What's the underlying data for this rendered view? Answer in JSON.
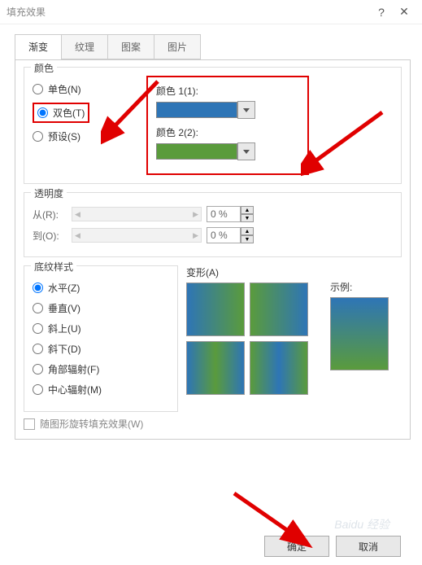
{
  "window": {
    "title": "填充效果",
    "help": "?",
    "close": "✕"
  },
  "tabs": {
    "gradient": "渐变",
    "texture": "纹理",
    "pattern": "图案",
    "picture": "图片"
  },
  "color": {
    "group": "颜色",
    "single": "单色(N)",
    "dual": "双色(T)",
    "preset": "预设(S)",
    "c1label": "颜色 1(1):",
    "c2label": "颜色 2(2):",
    "c1hex": "#2e75b6",
    "c2hex": "#5a9b3c"
  },
  "trans": {
    "group": "透明度",
    "from": "从(R):",
    "to": "到(O):",
    "fromVal": "0 %",
    "toVal": "0 %"
  },
  "shade": {
    "group": "底纹样式",
    "horiz": "水平(Z)",
    "vert": "垂直(V)",
    "diagUp": "斜上(U)",
    "diagDown": "斜下(D)",
    "corner": "角部辐射(F)",
    "center": "中心辐射(M)"
  },
  "variants": {
    "title": "变形(A)"
  },
  "sample": {
    "title": "示例:"
  },
  "rotate": {
    "label": "随图形旋转填充效果(W)"
  },
  "buttons": {
    "ok": "确定",
    "cancel": "取消"
  },
  "watermark": "Baidu 经验"
}
